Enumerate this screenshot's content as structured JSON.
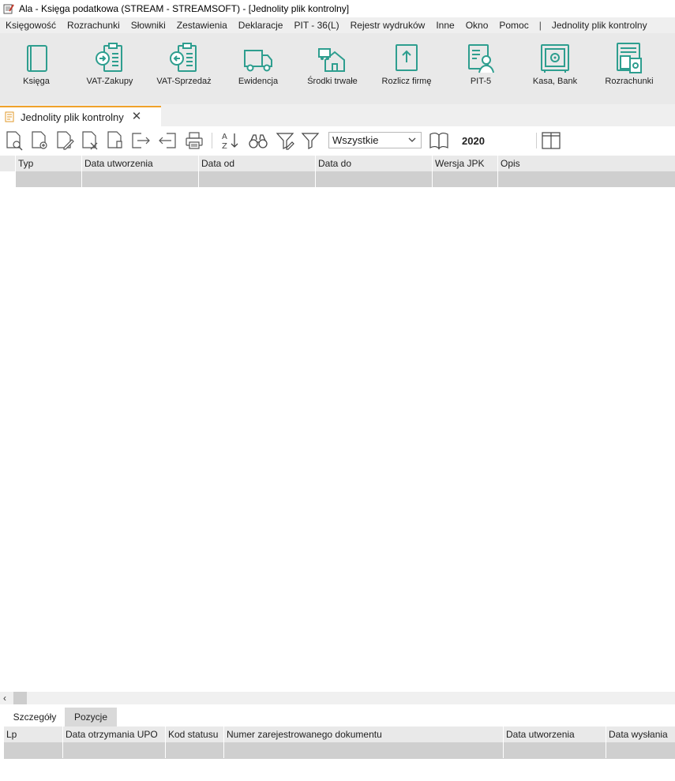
{
  "window": {
    "title": "Ala - Księga podatkowa (STREAM - STREAMSOFT) - [Jednolity plik kontrolny]"
  },
  "menu": {
    "items": [
      "Księgowość",
      "Rozrachunki",
      "Słowniki",
      "Zestawienia",
      "Deklaracje",
      "PIT - 36(L)",
      "Rejestr wydruków",
      "Inne",
      "Okno",
      "Pomoc"
    ],
    "separator": "|",
    "context": "Jednolity plik kontrolny"
  },
  "ribbon": {
    "buttons": [
      {
        "label": "Księga",
        "icon": "book-icon"
      },
      {
        "label": "VAT-Zakupy",
        "icon": "vat-purchase-icon"
      },
      {
        "label": "VAT-Sprzedaż",
        "icon": "vat-sale-icon"
      },
      {
        "label": "Ewidencja",
        "icon": "truck-icon"
      },
      {
        "label": "Środki trwałe",
        "icon": "fixed-assets-icon"
      },
      {
        "label": "Rozlicz firmę",
        "icon": "upload-document-icon"
      },
      {
        "label": "PIT-5",
        "icon": "person-document-icon"
      },
      {
        "label": "Kasa, Bank",
        "icon": "safe-icon"
      },
      {
        "label": "Rozrachunki",
        "icon": "settlements-icon"
      }
    ]
  },
  "document_tab": {
    "label": "Jednolity plik kontrolny",
    "close": "✕"
  },
  "toolbar": {
    "filter": {
      "selected": "Wszystkie"
    },
    "year": "2020"
  },
  "main_grid": {
    "columns": [
      "Typ",
      "Data utworzenia",
      "Data od",
      "Data do",
      "Wersja JPK",
      "Opis"
    ]
  },
  "bottom_tabs": [
    "Szczegóły",
    "Pozycje"
  ],
  "detail_grid": {
    "columns": [
      "Lp",
      "Data otrzymania UPO",
      "Kod statusu",
      "Numer zarejestrowanego dokumentu",
      "Data utworzenia",
      "Data wysłania"
    ]
  },
  "colors": {
    "accent": "#2e9e8f",
    "tab_accent": "#f0a22a",
    "ribbon_bg": "#e9e9e9",
    "row_bg": "#cfcfcf"
  }
}
